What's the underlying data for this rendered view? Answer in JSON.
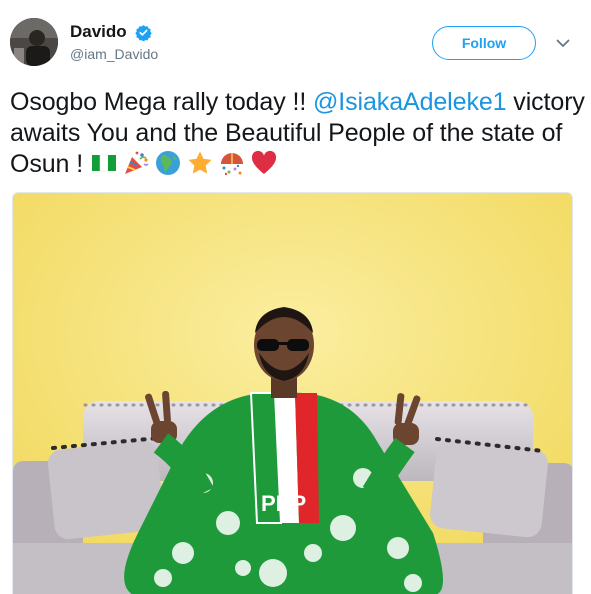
{
  "author": {
    "display_name": "Davido",
    "handle": "@iam_Davido",
    "verified": true
  },
  "actions": {
    "follow_label": "Follow"
  },
  "tweet": {
    "text_before_mention": "Osogbo Mega rally today !! ",
    "mention": "@IsiakaAdeleke1",
    "text_after_mention": " victory awaits You and the Beautiful People of the state of Osun ! ",
    "emojis": [
      "flag-nigeria",
      "party-popper",
      "globe-africa",
      "star",
      "confetti-ball",
      "red-heart"
    ]
  },
  "media": {
    "sash_letters": "PDP",
    "wall_color": "#f7e27a",
    "outfit_color": "#1f9a3b",
    "sash_colors": [
      "#1f9a3b",
      "#ffffff",
      "#e0262a"
    ]
  },
  "colors": {
    "accent": "#1da1f2",
    "mention": "#1b95e0",
    "text": "#14171a",
    "secondary_text": "#657786"
  }
}
